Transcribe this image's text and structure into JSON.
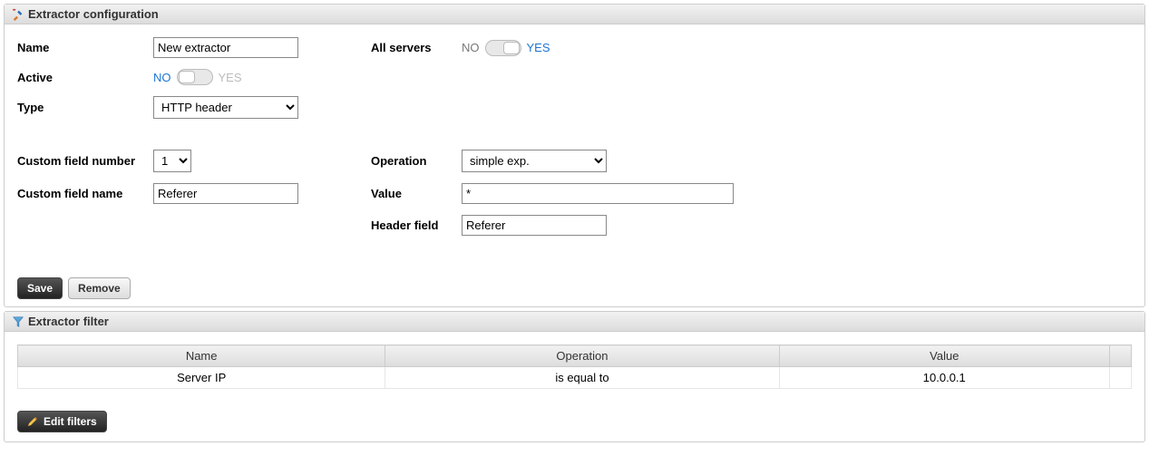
{
  "config": {
    "title": "Extractor configuration",
    "labels": {
      "name": "Name",
      "active": "Active",
      "type": "Type",
      "custom_field_number": "Custom field number",
      "custom_field_name": "Custom field name",
      "all_servers": "All servers",
      "operation": "Operation",
      "value": "Value",
      "header_field": "Header field"
    },
    "name_value": "New extractor",
    "active": {
      "no": "NO",
      "yes": "YES",
      "state": "off"
    },
    "type_value": "HTTP header",
    "custom_field_number_value": "1",
    "custom_field_name_value": "Referer",
    "all_servers": {
      "no": "NO",
      "yes": "YES",
      "state": "on"
    },
    "operation_value": "simple exp.",
    "value_value": "*",
    "header_field_value": "Referer",
    "save_label": "Save",
    "remove_label": "Remove"
  },
  "filter": {
    "title": "Extractor filter",
    "columns": {
      "name": "Name",
      "operation": "Operation",
      "value": "Value"
    },
    "rows": [
      {
        "name": "Server IP",
        "operation": "is equal to",
        "value": "10.0.0.1"
      }
    ],
    "edit_label": "Edit filters"
  }
}
